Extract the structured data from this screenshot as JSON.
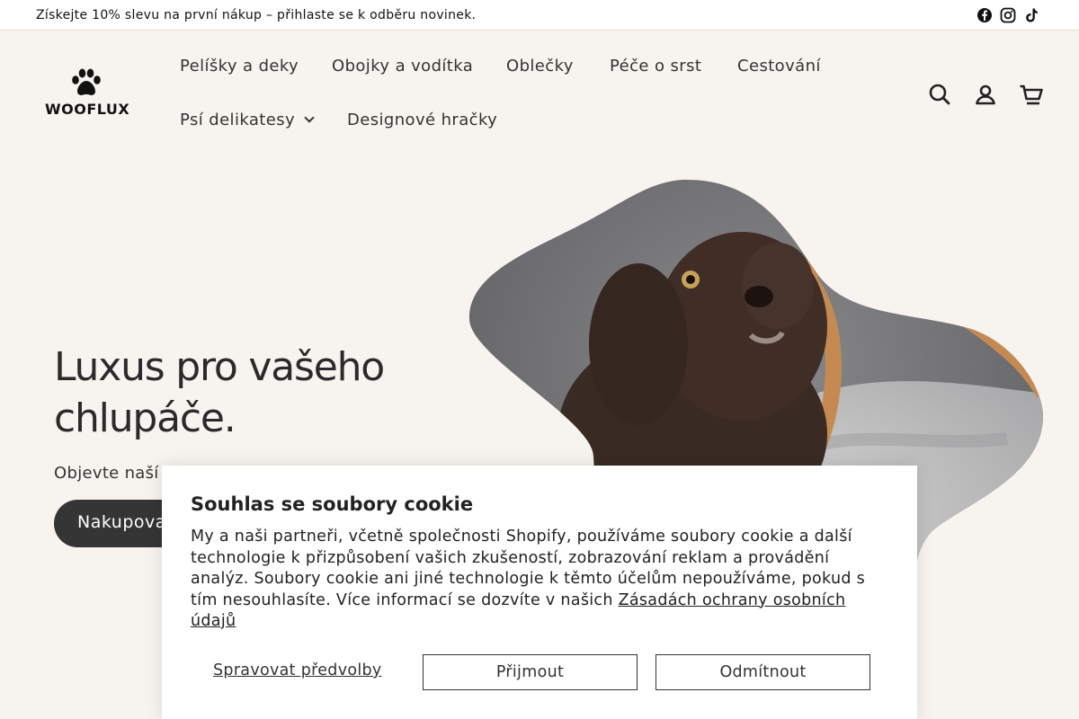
{
  "announcement": {
    "text": "Získejte 10% slevu na první nákup – přihlaste se k odběru novinek.",
    "social_icons": [
      "facebook-icon",
      "instagram-icon",
      "tiktok-icon"
    ]
  },
  "brand": {
    "name": "WOOFLUX"
  },
  "nav": {
    "items": [
      {
        "label": "Pelíšky a deky"
      },
      {
        "label": "Obojky a vodítka"
      },
      {
        "label": "Oblečky"
      },
      {
        "label": "Péče o srst"
      },
      {
        "label": "Cestování"
      },
      {
        "label": "Psí delikatesy"
      },
      {
        "label": "Designové hračky"
      }
    ]
  },
  "header_icons": [
    "search-icon",
    "account-icon",
    "cart-icon"
  ],
  "hero": {
    "title_line1": "Luxus pro vašeho",
    "title_line2": "chlupáče.",
    "subtitle": "Objevte naší",
    "button_label": "Nakupovat"
  },
  "cookie": {
    "title": "Souhlas se soubory cookie",
    "body": "My a naši partneři, včetně společnosti Shopify, používáme soubory cookie a další technologie k přizpůsobení vašich zkušeností, zobrazování reklam a provádění analýz. Soubory cookie ani jiné technologie k těmto účelům nepoužíváme, pokud s tím nesouhlasíte. Více informací se dozvíte v našich ",
    "link": "Zásadách ochrany osobních údajů",
    "manage_label": "Spravovat předvolby",
    "accept_label": "Přijmout",
    "decline_label": "Odmítnout"
  },
  "colors": {
    "page_bg": "#f7f4ef",
    "button_dark": "#353535",
    "text": "#2a2a2a"
  }
}
